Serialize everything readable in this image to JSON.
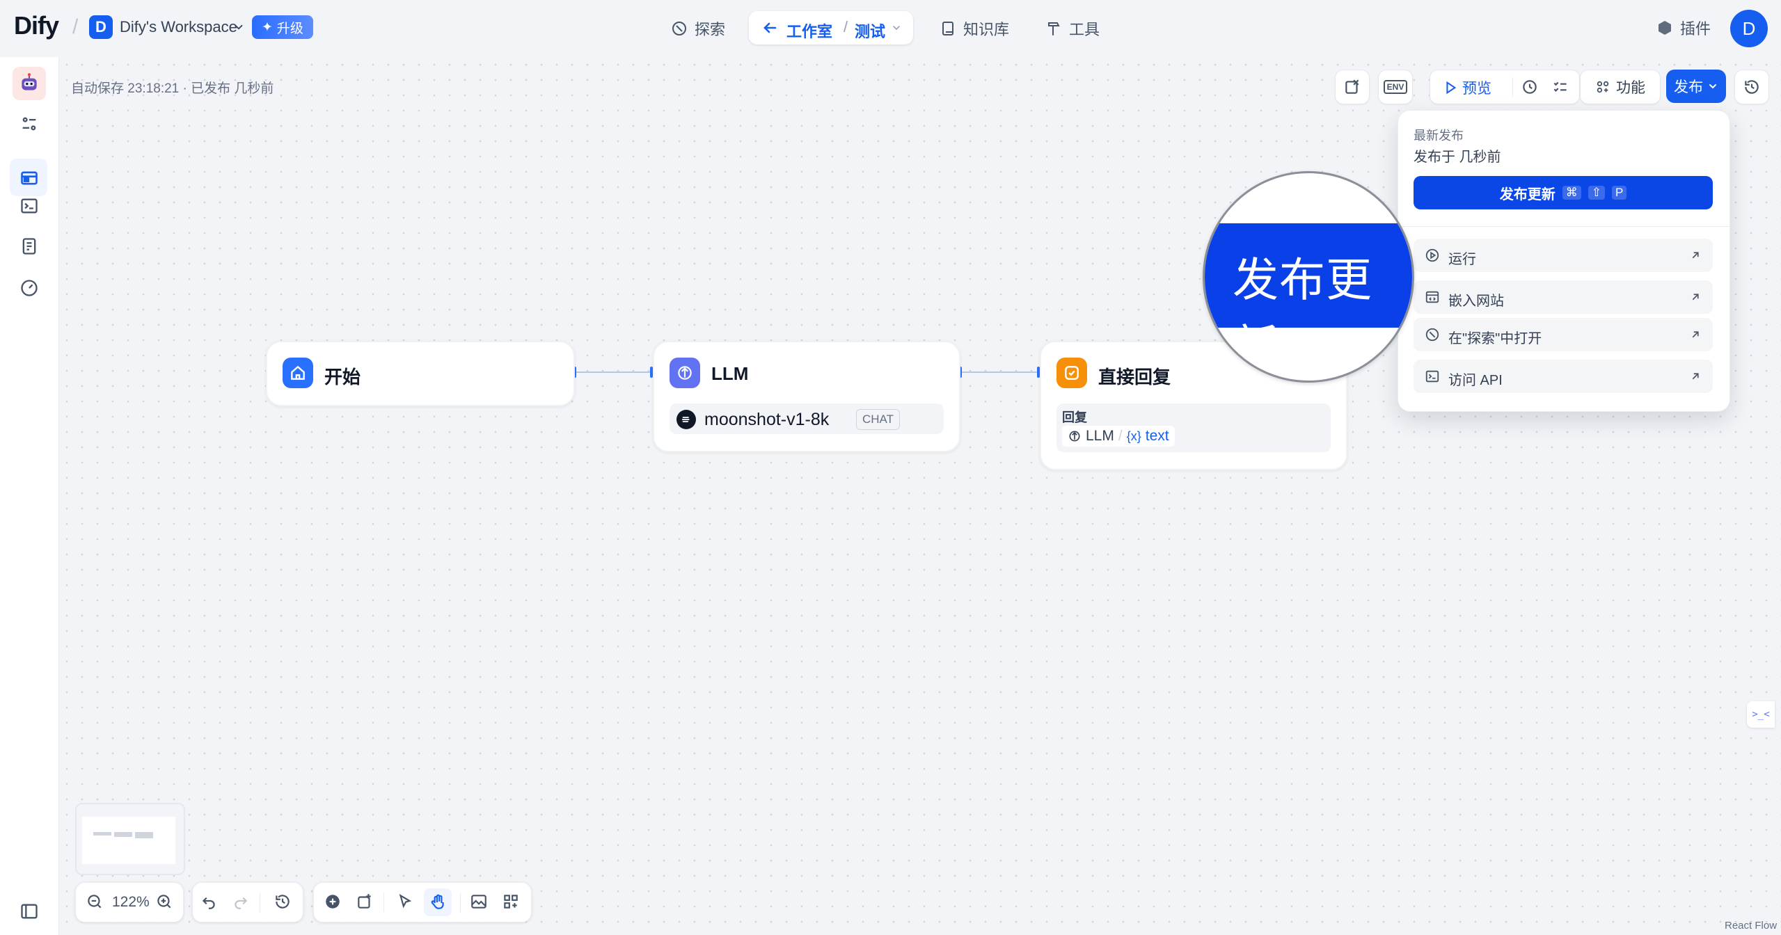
{
  "brand": {
    "logo": "Dify"
  },
  "workspace": {
    "avatar_letter": "D",
    "name": "Dify's Workspace",
    "upgrade_label": "升级"
  },
  "nav": {
    "explore": "探索",
    "studio": "工作室",
    "slash": "/",
    "app_name": "测试",
    "knowledge": "知识库",
    "tools": "工具"
  },
  "header_right": {
    "plugins": "插件",
    "user_letter": "D"
  },
  "canvas": {
    "autosave": "自动保存 23:18:21 · 已发布 几秒前",
    "react_flow": "React Flow",
    "zoom": "122%"
  },
  "toolbar": {
    "env": "ENV",
    "preview": "预览",
    "features": "功能",
    "publish": "发布"
  },
  "nodes": {
    "start": {
      "title": "开始"
    },
    "llm": {
      "title": "LLM",
      "model": "moonshot-v1-8k",
      "mode": "CHAT"
    },
    "answer": {
      "title": "直接回复",
      "label": "回复",
      "var_node": "LLM",
      "var_sep": "/",
      "var_name": "text"
    }
  },
  "publish_panel": {
    "latest_label": "最新发布",
    "published_at": "发布于 几秒前",
    "update_button": "发布更新",
    "shortcut_keys": [
      "⌘",
      "⇧",
      "P"
    ],
    "items": [
      {
        "label": "运行",
        "icon": "play-circle-icon"
      },
      {
        "label": "嵌入网站",
        "icon": "embed-icon"
      },
      {
        "label": "在\"探索\"中打开",
        "icon": "compass-icon"
      },
      {
        "label": "访问 API",
        "icon": "terminal-icon"
      }
    ]
  },
  "magnifier": {
    "text": "发布更新"
  },
  "colors": {
    "primary": "#155eef",
    "start_node": "#2970ff",
    "llm_node": "#6172f3",
    "answer_node": "#f79009"
  }
}
